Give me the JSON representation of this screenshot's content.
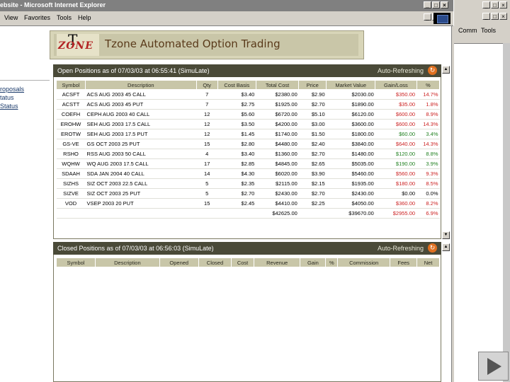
{
  "window": {
    "title": "ebsite - Microsoft Internet Explorer",
    "menu": [
      "View",
      "Favorites",
      "Tools",
      "Help"
    ]
  },
  "right_pane": {
    "menu": [
      "Comm",
      "Tools"
    ]
  },
  "left_nav": {
    "items": [
      "roposals",
      "tatus",
      "Status"
    ]
  },
  "banner": {
    "logo_t": "T",
    "logo_zone": "ZONE",
    "title": "Tzone Automated Option Trading"
  },
  "open_positions": {
    "title": "Open Positions as of 07/03/03 at 06:55:41 (SimuLate)",
    "auto_refresh": "Auto-Refreshing",
    "columns": [
      "Symbol",
      "Description",
      "Qty",
      "Cost Basis",
      "Total Cost",
      "Price",
      "Market Value",
      "Gain/Loss",
      "%"
    ],
    "rows": [
      [
        "ACSFT",
        "ACS AUG 2003 45 CALL",
        "7",
        "$3.40",
        "$2380.00",
        "$2.90",
        "$2030.00",
        "$350.00",
        "14.7%"
      ],
      [
        "ACSTT",
        "ACS AUG 2003 45 PUT",
        "7",
        "$2.75",
        "$1925.00",
        "$2.70",
        "$1890.00",
        "$35.00",
        "1.8%"
      ],
      [
        "COEFH",
        "CEPH AUG 2003 40 CALL",
        "12",
        "$5.60",
        "$6720.00",
        "$5.10",
        "$6120.00",
        "$600.00",
        "8.9%"
      ],
      [
        "EROHW",
        "SEH AUG 2003 17.5 CALL",
        "12",
        "$3.50",
        "$4200.00",
        "$3.00",
        "$3600.00",
        "$600.00",
        "14.3%"
      ],
      [
        "EROTW",
        "SEH AUG 2003 17.5 PUT",
        "12",
        "$1.45",
        "$1740.00",
        "$1.50",
        "$1800.00",
        "$60.00",
        "3.4%"
      ],
      [
        "GS-VE",
        "GS OCT 2003 25 PUT",
        "15",
        "$2.80",
        "$4480.00",
        "$2.40",
        "$3840.00",
        "$640.00",
        "14.3%"
      ],
      [
        "RSHO",
        "RSS AUG 2003 50 CALL",
        "4",
        "$3.40",
        "$1360.00",
        "$2.70",
        "$1480.00",
        "$120.00",
        "8.8%"
      ],
      [
        "WQHW",
        "WQ AUG 2003 17.5 CALL",
        "17",
        "$2.85",
        "$4845.00",
        "$2.65",
        "$5035.00",
        "$190.00",
        "3.9%"
      ],
      [
        "SDAAH",
        "SDA JAN 2004 40 CALL",
        "14",
        "$4.30",
        "$6020.00",
        "$3.90",
        "$5460.00",
        "$560.00",
        "9.3%"
      ],
      [
        "SIZHS",
        "SIZ OCT 2003 22.5 CALL",
        "5",
        "$2.35",
        "$2115.00",
        "$2.15",
        "$1935.00",
        "$180.00",
        "8.5%"
      ],
      [
        "SIZVE",
        "SIZ OCT 2003 25 PUT",
        "5",
        "$2.70",
        "$2430.00",
        "$2.70",
        "$2430.00",
        "$0.00",
        "0.0%"
      ],
      [
        "VOD",
        "VSEP 2003 20 PUT",
        "15",
        "$2.45",
        "$4410.00",
        "$2.25",
        "$4050.00",
        "$360.00",
        "8.2%"
      ]
    ],
    "row_signs": [
      "neg",
      "neg",
      "neg",
      "neg",
      "pos",
      "neg",
      "pos",
      "pos",
      "neg",
      "neg",
      "zero",
      "neg"
    ],
    "totals": {
      "total_cost": "$42625.00",
      "market_value": "$39670.00",
      "gain_loss": "$2955.00",
      "pct": "6.9%"
    }
  },
  "closed_positions": {
    "title": "Closed Positions as of 07/03/03 at 06:56:03 (SimuLate)",
    "auto_refresh": "Auto-Refreshing",
    "columns": [
      "Symbol",
      "Description",
      "Opened",
      "Closed",
      "Cost",
      "Revenue",
      "Gain",
      "%",
      "Commission",
      "Fees",
      "Net"
    ]
  },
  "colors": {
    "loss": "#cc2020",
    "gain": "#208020",
    "panel_header": "#4a4a38",
    "banner_bg": "#d8d5b8"
  }
}
